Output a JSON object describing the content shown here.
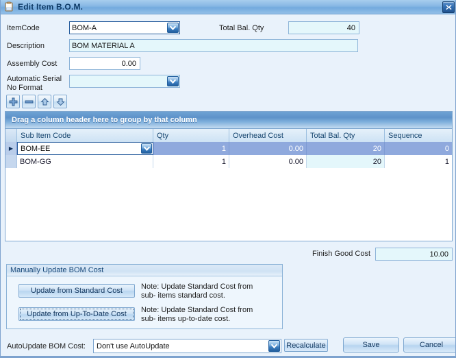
{
  "window": {
    "title": "Edit Item B.O.M.",
    "icon": "clipboard-icon",
    "close_label": "✕",
    "frame_color": "#7da2ce",
    "titlebar_color": "#86b7e4"
  },
  "form": {
    "itemcode": {
      "label": "ItemCode",
      "value": "BOM-A",
      "focused": true
    },
    "description": {
      "label": "Description",
      "value": "BOM MATERIAL A"
    },
    "assembly_cost": {
      "label": "Assembly Cost",
      "value": "0.00"
    },
    "serial_format": {
      "label": "Automatic Serial\nNo Format",
      "label_line1": "Automatic Serial",
      "label_line2": "No Format",
      "value": ""
    },
    "total_bal_qty": {
      "label": "Total Bal. Qty",
      "value": "40"
    }
  },
  "record_toolbar": {
    "buttons": [
      {
        "name": "add-record-button",
        "icon": "plus-icon",
        "label": "+"
      },
      {
        "name": "delete-record-button",
        "icon": "minus-icon",
        "label": "−"
      },
      {
        "name": "move-up-button",
        "icon": "arrow-up-icon",
        "label": "▲"
      },
      {
        "name": "move-down-button",
        "icon": "arrow-down-icon",
        "label": "▼"
      }
    ]
  },
  "grid": {
    "group_panel_text": "Drag a column header here to group by that column",
    "columns": [
      {
        "key": "sub_item_code",
        "label": "Sub Item Code",
        "align": "left"
      },
      {
        "key": "qty",
        "label": "Qty",
        "align": "right"
      },
      {
        "key": "overhead_cost",
        "label": "Overhead Cost",
        "align": "right"
      },
      {
        "key": "total_bal_qty",
        "label": "Total Bal. Qty",
        "align": "right"
      },
      {
        "key": "sequence",
        "label": "Sequence",
        "align": "right"
      }
    ],
    "rows": [
      {
        "selected": true,
        "indicator": "▶",
        "sub_item_code": "BOM-EE",
        "qty": "1",
        "overhead_cost": "0.00",
        "total_bal_qty": "20",
        "sequence": "0"
      },
      {
        "selected": false,
        "indicator": "",
        "sub_item_code": "BOM-GG",
        "qty": "1",
        "overhead_cost": "0.00",
        "total_bal_qty": "20",
        "sequence": "1"
      }
    ]
  },
  "finish_good_cost": {
    "label": "Finish Good Cost",
    "value": "10.00"
  },
  "manual_update": {
    "group_title": "Manually Update BOM Cost",
    "standard_button": "Update from Standard Cost",
    "standard_note_line1": "Note: Update Standard Cost from sub-",
    "standard_note_line2": "items standard cost.",
    "uptodate_button": "Update from Up-To-Date Cost",
    "uptodate_note_line1": "Note: Update Standard Cost from sub-",
    "uptodate_note_line2": "items up-to-date cost."
  },
  "footer": {
    "autoupdate_label": "AutoUpdate BOM Cost:",
    "autoupdate_value": "Don't use AutoUpdate",
    "autoupdate_options": [
      "Don't use AutoUpdate"
    ],
    "recalculate_label": "Recalculate",
    "save_label": "Save",
    "cancel_label": "Cancel"
  }
}
